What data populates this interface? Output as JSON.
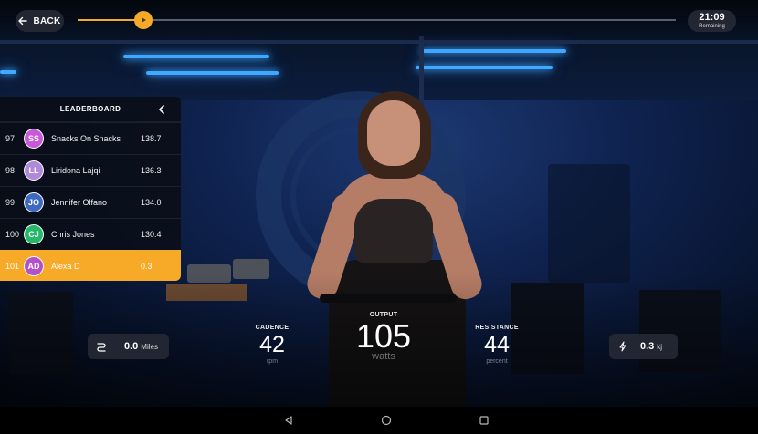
{
  "topbar": {
    "back_label": "BACK",
    "progress_fraction": 0.11,
    "timer_value": "21:09",
    "timer_label": "Remaining"
  },
  "leaderboard": {
    "title": "LEADERBOARD",
    "rows": [
      {
        "rank": "97",
        "initials": "SS",
        "name": "Snacks On Snacks",
        "score": "138.7",
        "color": "#c75ad6"
      },
      {
        "rank": "98",
        "initials": "LL",
        "name": "Liridona Lajqi",
        "score": "136.3",
        "color": "#b08ad8"
      },
      {
        "rank": "99",
        "initials": "JO",
        "name": "Jennifer Olfano",
        "score": "134.0",
        "color": "#3d6ac0"
      },
      {
        "rank": "100",
        "initials": "CJ",
        "name": "Chris Jones",
        "score": "130.4",
        "color": "#27b86a"
      },
      {
        "rank": "101",
        "initials": "AD",
        "name": "Alexa D",
        "score": "0.3",
        "color": "#b451c9",
        "highlight": true
      }
    ]
  },
  "metrics": {
    "distance": {
      "value": "0.0",
      "unit": "Miles",
      "icon": "distance-icon"
    },
    "energy": {
      "value": "0.3",
      "unit": "kj",
      "icon": "lightning-icon"
    },
    "cadence": {
      "label": "CADENCE",
      "value": "42",
      "unit": "rpm"
    },
    "output": {
      "label": "OUTPUT",
      "value": "105",
      "unit": "watts"
    },
    "resistance": {
      "label": "RESISTANCE",
      "value": "44",
      "unit": "percent"
    }
  },
  "colors": {
    "accent": "#f7a928",
    "highlight_row": "#f7a928"
  },
  "navbar": {
    "icons": [
      "back-triangle-icon",
      "home-circle-icon",
      "recents-square-icon"
    ]
  }
}
